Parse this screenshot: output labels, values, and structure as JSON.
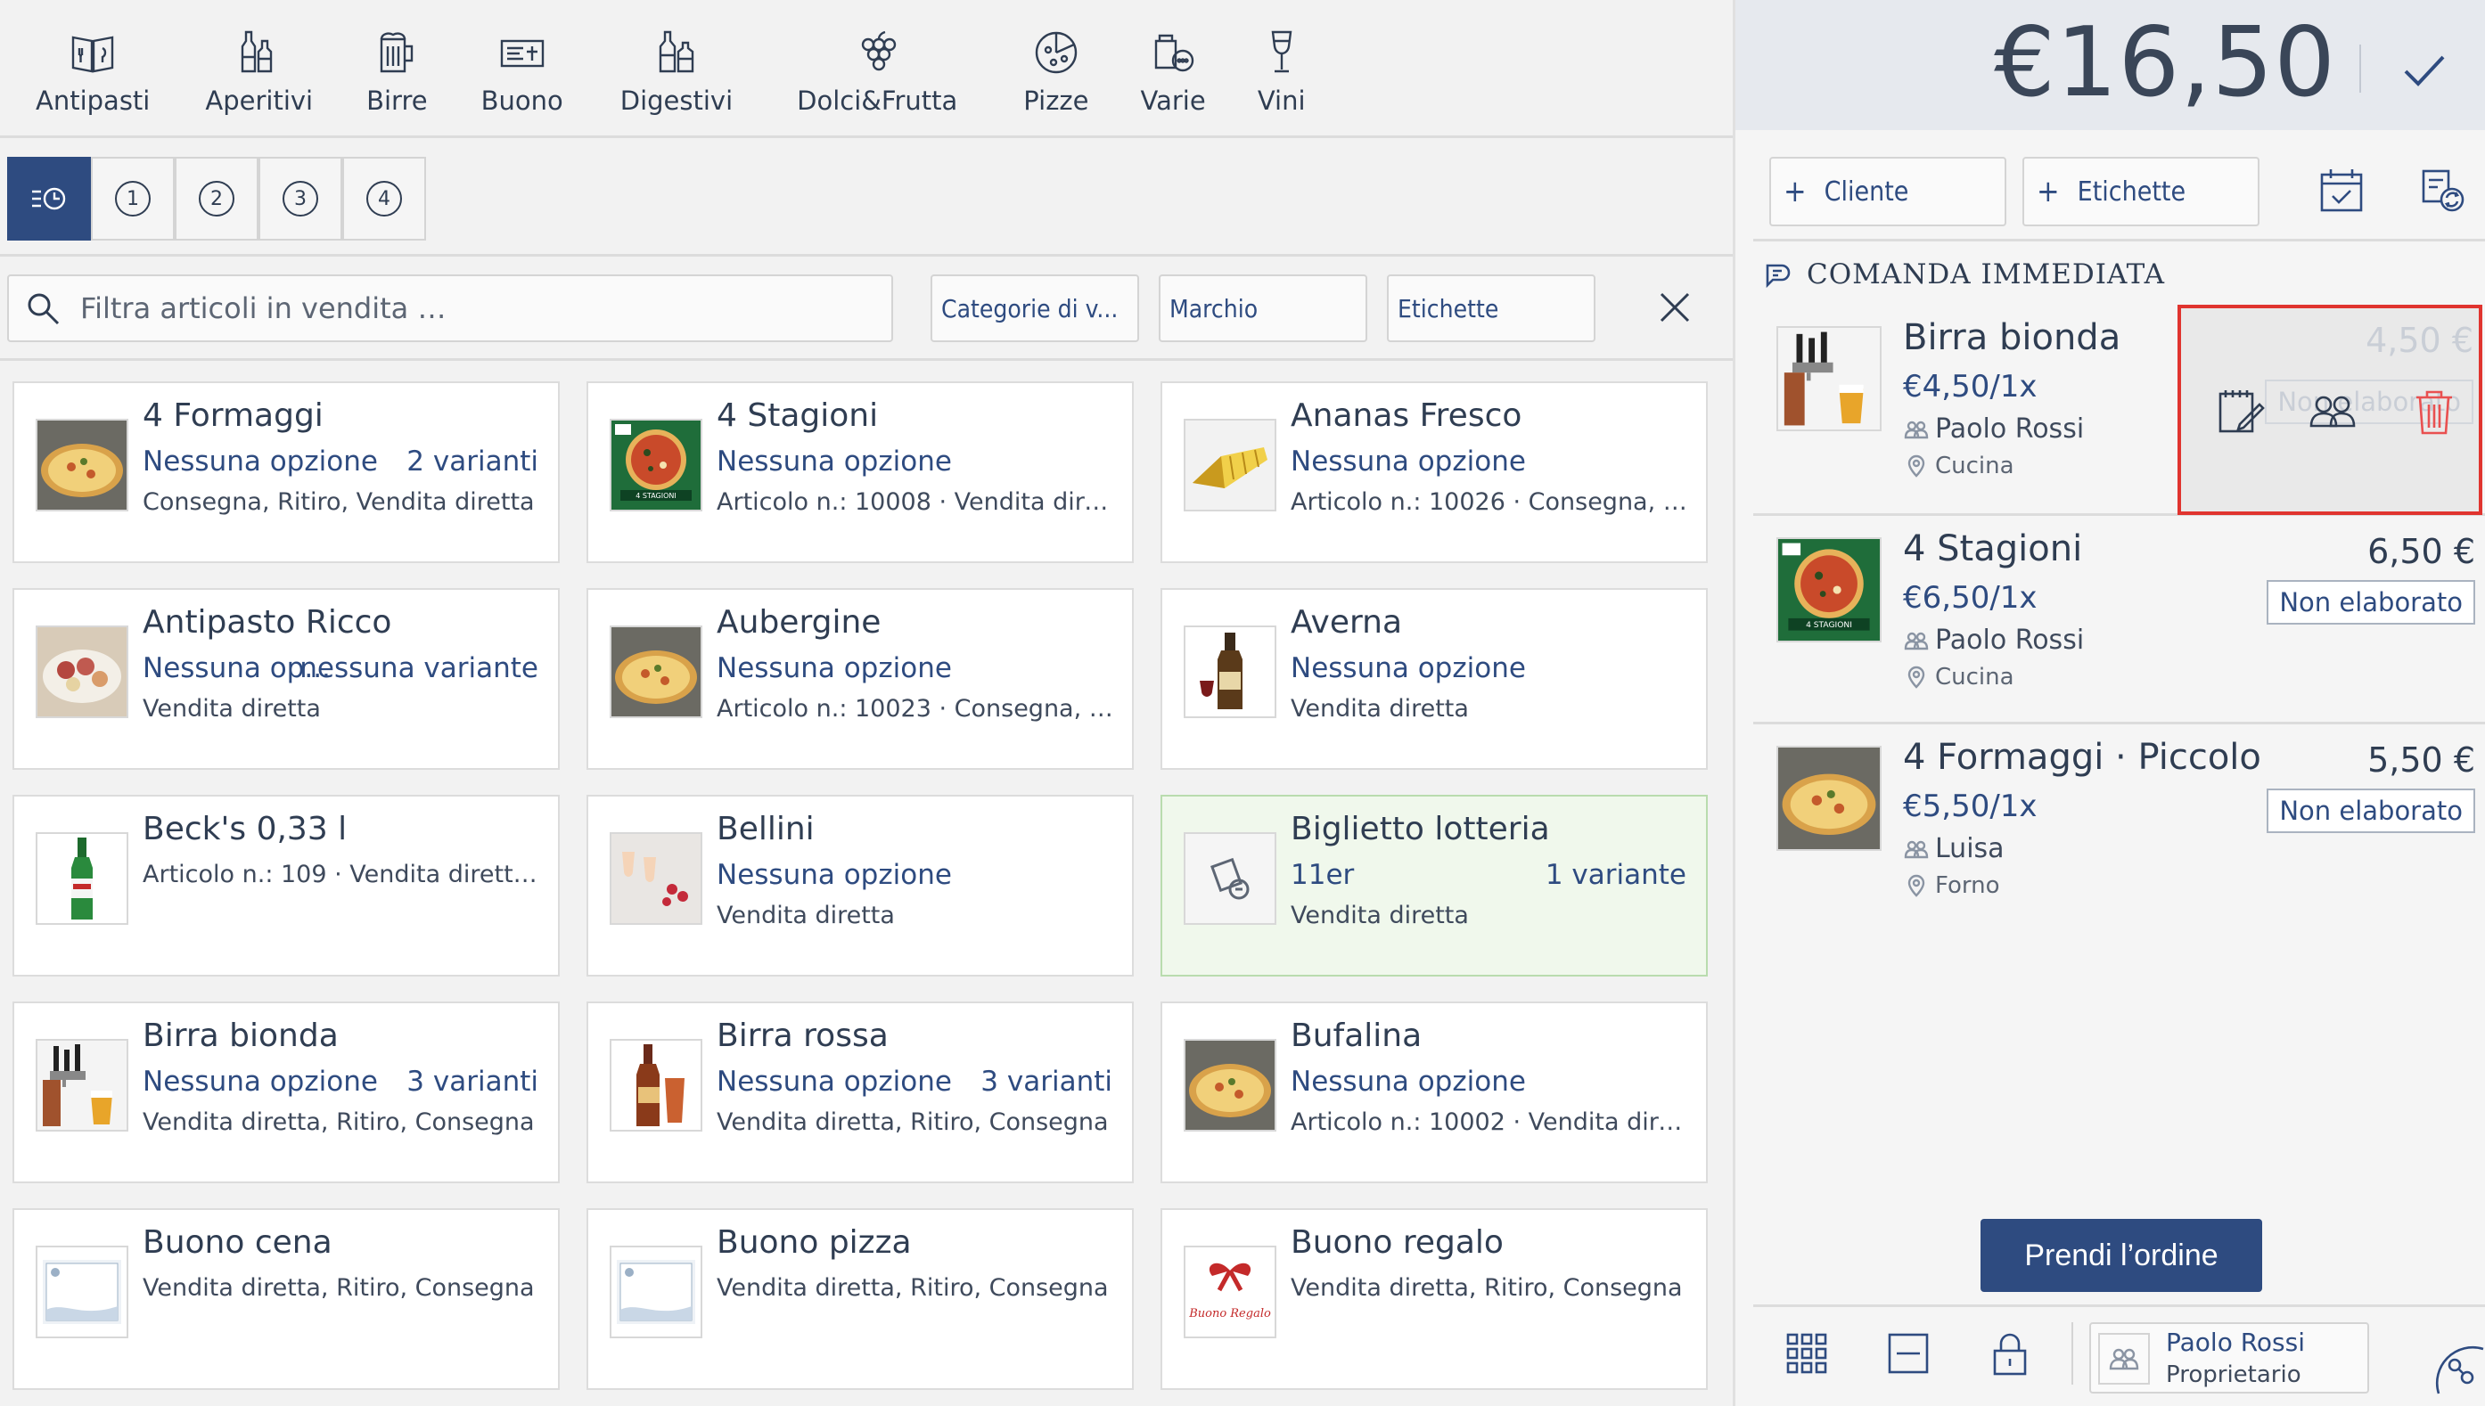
{
  "categories": [
    {
      "label": "Antipasti",
      "icon": "menu-book-icon"
    },
    {
      "label": "Aperitivi",
      "icon": "bottles-icon"
    },
    {
      "label": "Birre",
      "icon": "beer-mug-icon"
    },
    {
      "label": "Buono",
      "icon": "voucher-icon"
    },
    {
      "label": "Digestivi",
      "icon": "liquor-bottles-icon"
    },
    {
      "label": "Dolci&Frutta",
      "icon": "grapes-icon"
    },
    {
      "label": "Pizze",
      "icon": "pizza-icon"
    },
    {
      "label": "Varie",
      "icon": "misc-icon"
    },
    {
      "label": "Vini",
      "icon": "wine-glass-icon"
    }
  ],
  "courses": [
    "1",
    "2",
    "3",
    "4"
  ],
  "search": {
    "placeholder": "Filtra articoli in vendita …"
  },
  "filters": {
    "categorie": "Categorie di v...",
    "marchio": "Marchio",
    "etichette": "Etichette"
  },
  "products": [
    {
      "name": "4 Formaggi",
      "option": "Nessuna opzione",
      "variants": "2 varianti",
      "details": "Consegna, Ritiro, Vendita diretta",
      "image": "pizza"
    },
    {
      "name": "4 Stagioni",
      "option": "Nessuna opzione",
      "variants": "",
      "details": "Articolo n.: 10008 · Vendita dirett...",
      "image": "pizza-box"
    },
    {
      "name": "Ananas Fresco",
      "option": "Nessuna opzione",
      "variants": "",
      "details": "Articolo n.: 10026 · Consegna, Rit...",
      "image": "pineapple"
    },
    {
      "name": "Antipasto Ricco",
      "option": "Nessuna op...",
      "variants": "nessuna variante",
      "details": "Vendita diretta",
      "image": "antipasto"
    },
    {
      "name": "Aubergine",
      "option": "Nessuna opzione",
      "variants": "",
      "details": "Articolo n.: 10023 · Consegna, Rit...",
      "image": "pizza"
    },
    {
      "name": "Averna",
      "option": "Nessuna opzione",
      "variants": "",
      "details": "Vendita diretta",
      "image": "liquor"
    },
    {
      "name": "Beck's 0,33 l",
      "option": "",
      "variants": "",
      "details": "Articolo n.: 109 · Vendita diretta, ...",
      "image": "beer-bottle"
    },
    {
      "name": "Bellini",
      "option": "Nessuna opzione",
      "variants": "",
      "details": "Vendita diretta",
      "image": "glasses"
    },
    {
      "name": "Biglietto lotteria",
      "option": "11er",
      "variants": "1 variante",
      "details": "Vendita diretta",
      "image": "ticket-icon"
    },
    {
      "name": "Birra bionda",
      "option": "Nessuna opzione",
      "variants": "3 varianti",
      "details": "Vendita diretta, Ritiro, Consegna",
      "image": "beer-tap"
    },
    {
      "name": "Birra rossa",
      "option": "Nessuna opzione",
      "variants": "3 varianti",
      "details": "Vendita diretta, Ritiro, Consegna",
      "image": "red-beer"
    },
    {
      "name": "Bufalina",
      "option": "Nessuna opzione",
      "variants": "",
      "details": "Articolo n.: 10002 · Vendita dirett...",
      "image": "pizza"
    },
    {
      "name": "Buono cena",
      "option": "",
      "variants": "",
      "details": "Vendita diretta, Ritiro, Consegna",
      "image": "voucher"
    },
    {
      "name": "Buono pizza",
      "option": "",
      "variants": "",
      "details": "Vendita diretta, Ritiro, Consegna",
      "image": "voucher"
    },
    {
      "name": "Buono regalo",
      "option": "",
      "variants": "",
      "details": "Vendita diretta, Ritiro, Consegna",
      "image": "gift"
    }
  ],
  "cart": {
    "total": "€16,50",
    "cliente_label": "Cliente",
    "etichette_label": "Etichette",
    "order_section": "COMANDA IMMEDIATA",
    "items": [
      {
        "name": "Birra bionda",
        "unit_price": "€4,50/1x",
        "user": "Paolo Rossi",
        "destination": "Cucina",
        "total": "4,50 €",
        "status": "Non elaborato",
        "image": "beer-tap"
      },
      {
        "name": "4 Stagioni",
        "unit_price": "€6,50/1x",
        "user": "Paolo Rossi",
        "destination": "Cucina",
        "total": "6,50 €",
        "status": "Non elaborato",
        "image": "pizza-box"
      },
      {
        "name": "4 Formaggi · Piccolo",
        "unit_price": "€5,50/1x",
        "user": "Luisa",
        "destination": "Forno",
        "total": "5,50 €",
        "status": "Non elaborato",
        "image": "pizza"
      }
    ],
    "take_order_label": "Prendi l’ordine"
  },
  "user": {
    "name": "Paolo Rossi",
    "role": "Proprietario"
  },
  "colors": {
    "primary": "#2e4b80",
    "text": "#2f3d52",
    "highlight": "#f0f8ec",
    "danger": "#e0342f",
    "delete": "#e95050"
  }
}
